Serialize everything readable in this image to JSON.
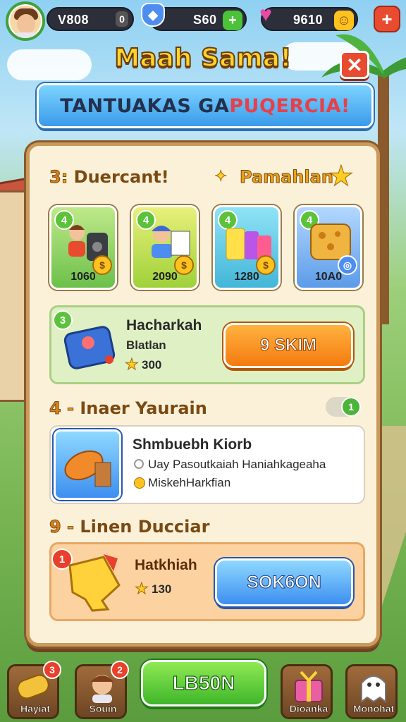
{
  "top_bar": {
    "coins_value": "V808",
    "coins_badge": "0",
    "gems_value": "S60",
    "energy_value": "9610",
    "plus_label": "+"
  },
  "header": {
    "title": "Maah Sama!",
    "close_label": "✕",
    "banner_main": "TANTUAKAS GA ",
    "banner_highlight": "PUQERCIA!"
  },
  "section1": {
    "number": "3",
    "title": "Duercant!",
    "subtitle": "Pamahlan",
    "items": [
      {
        "badge": "4",
        "price": "1060"
      },
      {
        "badge": "4",
        "price": "2090"
      },
      {
        "badge": "4",
        "price": "1280"
      },
      {
        "badge": "4",
        "price": "10A0"
      }
    ],
    "offer": {
      "badge": "3",
      "name": "Hacharkah",
      "desc": "Blatlan",
      "price": "300",
      "button": "9 SKIM"
    }
  },
  "section2": {
    "number": "4",
    "title": "Inaer Yaurain",
    "toggle_value": "1",
    "info": {
      "title": "Shmbuebh Kiorb",
      "line1": "Uay Pasoutkaiah Haniahkageaha",
      "line2": "MiskehHarkfian"
    }
  },
  "section3": {
    "number": "9",
    "title": "Linen Ducciar",
    "deal": {
      "badge": "1",
      "name": "Hatkhiah",
      "price": "130",
      "button": "SOK6ON"
    }
  },
  "bottom_nav": {
    "left1_label": "Hayiat",
    "left1_badge": "3",
    "left2_label": "Souin",
    "left2_badge": "2",
    "play_label": "LB50N",
    "right1_label": "Dioanka",
    "right2_label": "Monohat"
  },
  "colors": {
    "title_gold": "#ffd52a",
    "panel_bg": "#fbf1d9",
    "accent_orange": "#f47b10",
    "accent_blue": "#3d8ff0",
    "accent_green": "#3fb62a",
    "accent_red": "#e84b2f"
  }
}
